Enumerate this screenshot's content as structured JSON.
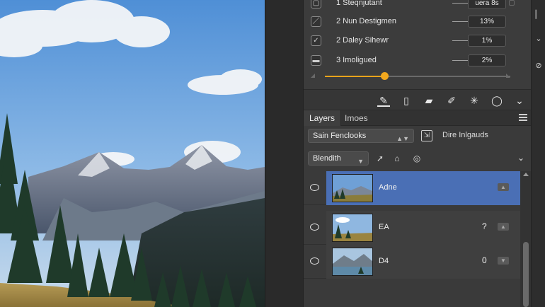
{
  "adjustments": [
    {
      "label": "1 Steqnjutant",
      "value": "uera 8s",
      "checked": false
    },
    {
      "label": "2 Nun Destigmen",
      "value": "13%",
      "checked": false
    },
    {
      "label": "2 Daley Sihewr",
      "value": "1%",
      "checked": true
    },
    {
      "label": "3 Imoligued",
      "value": "2%",
      "checked": false
    }
  ],
  "slider": {
    "value": 0.32
  },
  "toolbar": {
    "icons": [
      "mask-brush-icon",
      "bookmark-icon",
      "fill-icon",
      "brush-icon",
      "sparkle-icon",
      "circle-icon",
      "chevron-down-icon"
    ]
  },
  "tabs": [
    {
      "label": "Layers",
      "active": true
    },
    {
      "label": "Imoes",
      "active": false
    }
  ],
  "filter": {
    "dropdown": "Sain Fenclooks",
    "label": "Dire Inlgauds"
  },
  "blend": {
    "mode": "Blendith"
  },
  "layers": [
    {
      "name": "Adne",
      "glyph": "",
      "selected": true
    },
    {
      "name": "EA",
      "glyph": "?",
      "selected": false
    },
    {
      "name": "D4",
      "glyph": "0",
      "selected": false
    }
  ]
}
